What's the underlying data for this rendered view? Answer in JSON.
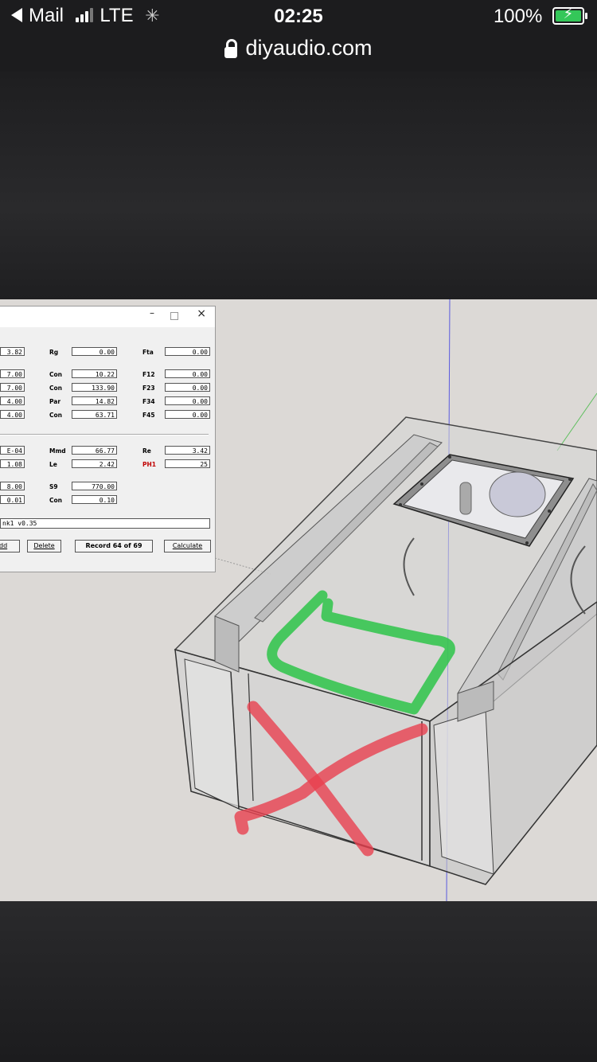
{
  "status_bar": {
    "back_app": "Mail",
    "network": "LTE",
    "time": "02:25",
    "battery": "100%",
    "colors": {
      "battery_fill": "#34c759"
    }
  },
  "browser": {
    "url": "diyaudio.com"
  },
  "dialog": {
    "titlebar_controls": [
      "–",
      "□",
      "×"
    ],
    "col1_fields": [
      "3.82",
      "7.00",
      "7.00",
      "4.00",
      "4.00",
      "E-04",
      "1.08",
      "8.00",
      "0.01"
    ],
    "col2_labels": [
      "Rg",
      "Con",
      "Con",
      "Par",
      "Con",
      "Mmd",
      "Le",
      "S9",
      "Con"
    ],
    "col2_fields": [
      "0.00",
      "10.22",
      "133.90",
      "14.82",
      "63.71",
      "66.77",
      "2.42",
      "770.00",
      "0.10"
    ],
    "col3_labels": [
      "Fta",
      "F12",
      "F23",
      "F34",
      "F45",
      "Re",
      "PH1"
    ],
    "col3_fields": [
      "0.00",
      "0.00",
      "0.00",
      "0.00",
      "0.00",
      "3.42",
      "25"
    ],
    "file_field": "nk1 v0.35",
    "buttons": {
      "add": "dd",
      "delete": "Delete",
      "record": "Record 64 of 69",
      "calculate": "Calculate"
    }
  }
}
